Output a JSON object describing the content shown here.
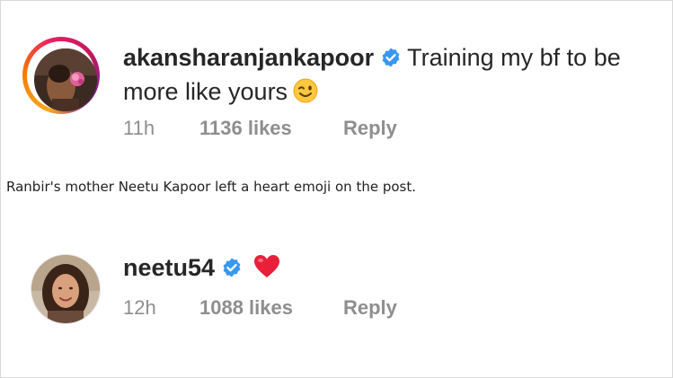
{
  "comments": [
    {
      "username": "akansharanjankapoor",
      "verified": true,
      "text": "Training my bf to be more like yours",
      "emoji": "winking-face-emoji",
      "time": "11h",
      "likes": "1136 likes",
      "reply_label": "Reply",
      "avatar_ring_colors": [
        "#f9a825",
        "#e91e63",
        "#7b1fa2"
      ]
    },
    {
      "username": "neetu54",
      "verified": true,
      "text": "",
      "emoji": "red-heart-emoji",
      "time": "12h",
      "likes": "1088 likes",
      "reply_label": "Reply"
    }
  ],
  "caption": "Ranbir's mother Neetu Kapoor left a heart emoji on the post.",
  "colors": {
    "text": "#262626",
    "meta": "#8e8e8e",
    "verified_badge": "#3897f0",
    "heart": "#ed4956"
  }
}
